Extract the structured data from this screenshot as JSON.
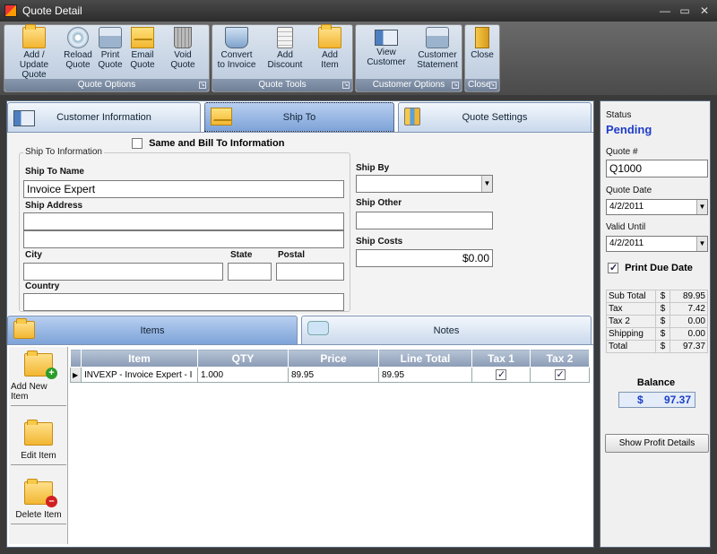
{
  "window": {
    "title": "Quote Detail",
    "controls": [
      "—",
      "▭",
      "✕"
    ]
  },
  "ribbon": {
    "groups": [
      {
        "label": "Quote Options",
        "buttons": [
          {
            "label": "Add / Update Quote",
            "icon": "folder-icon"
          },
          {
            "label": "Reload Quote",
            "icon": "reload-icon"
          },
          {
            "label": "Print Quote",
            "icon": "printer-icon"
          },
          {
            "label": "Email Quote",
            "icon": "email-icon"
          },
          {
            "label": "Void Quote",
            "icon": "trash-icon"
          }
        ]
      },
      {
        "label": "Quote Tools",
        "buttons": [
          {
            "label": "Convert to Invoice",
            "icon": "cart-icon"
          },
          {
            "label": "Add Discount",
            "icon": "calculator-icon"
          },
          {
            "label": "Add Item",
            "icon": "folder-add-icon"
          }
        ]
      },
      {
        "label": "Customer Options",
        "buttons": [
          {
            "label": "View Customer",
            "icon": "contact-card-icon"
          },
          {
            "label": "Customer Statement",
            "icon": "printer-icon"
          }
        ]
      },
      {
        "label": "Close",
        "buttons": [
          {
            "label": "Close",
            "icon": "door-icon"
          }
        ]
      }
    ]
  },
  "top_tabs": [
    "Customer Information",
    "Ship To",
    "Quote Settings"
  ],
  "shipto": {
    "same_bill_label": "Same and Bill To Information",
    "group_label": "Ship To Information",
    "name_label": "Ship To Name",
    "name_value": "Invoice Expert",
    "address_label": "Ship Address",
    "address_line1": "",
    "address_line2": "",
    "city_label": "City",
    "city_value": "",
    "state_label": "State",
    "state_value": "",
    "postal_label": "Postal",
    "postal_value": "",
    "country_label": "Country",
    "country_value": "",
    "ship_by_label": "Ship By",
    "ship_by_value": "",
    "ship_other_label": "Ship Other",
    "ship_other_value": "",
    "ship_costs_label": "Ship Costs",
    "ship_costs_value": "$0.00"
  },
  "bottom_tabs": [
    "Items",
    "Notes"
  ],
  "item_actions": [
    "Add New Item",
    "Edit Item",
    "Delete Item"
  ],
  "grid": {
    "columns": [
      "Item",
      "QTY",
      "Price",
      "Line Total",
      "Tax 1",
      "Tax 2"
    ],
    "rows": [
      {
        "item": "INVEXP - Invoice Expert - I",
        "qty": "1.000",
        "price": "89.95",
        "line_total": "89.95",
        "tax1": true,
        "tax2": true
      }
    ]
  },
  "status": {
    "status_label": "Status",
    "status_value": "Pending",
    "quote_no_label": "Quote #",
    "quote_no_value": "Q1000",
    "quote_date_label": "Quote Date",
    "quote_date_value": "4/2/2011",
    "valid_until_label": "Valid Until",
    "valid_until_value": "4/2/2011",
    "print_due_label": "Print Due Date",
    "print_due_checked": true
  },
  "totals": [
    {
      "label": "Sub Total",
      "currency": "$",
      "amount": "89.95"
    },
    {
      "label": "Tax",
      "currency": "$",
      "amount": "7.42"
    },
    {
      "label": "Tax 2",
      "currency": "$",
      "amount": "0.00"
    },
    {
      "label": "Shipping",
      "currency": "$",
      "amount": "0.00"
    },
    {
      "label": "Total",
      "currency": "$",
      "amount": "97.37"
    }
  ],
  "balance": {
    "label": "Balance",
    "currency": "$",
    "amount": "97.37"
  },
  "profit_button": "Show Profit Details",
  "colors": {
    "status": "#1e3ec8",
    "grid_header": "#8b9cb5",
    "ribbon_label": "#6f8097"
  }
}
